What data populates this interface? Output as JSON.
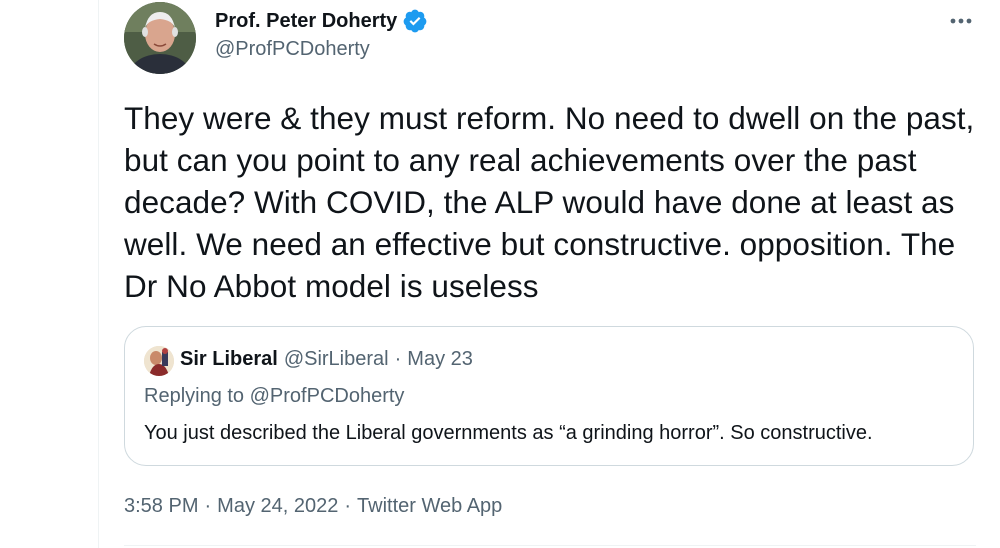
{
  "author": {
    "name": "Prof. Peter Doherty",
    "handle": "@ProfPCDoherty",
    "verified": true,
    "avatar_icon": "user-avatar-photo"
  },
  "tweet": {
    "text": "They were & they must reform. No need to dwell on the past, but can you point to any real achievements over the past decade? With COVID, the ALP would have done at least as well. We need an effective but constructive. opposition. The Dr No Abbot model is useless"
  },
  "quote": {
    "name": "Sir Liberal",
    "handle": "@SirLiberal",
    "separator": "·",
    "date": "May 23",
    "replying_to": "Replying to @ProfPCDoherty",
    "text": "You just described the Liberal governments as “a grinding horror”. So constructive."
  },
  "meta": {
    "time": "3:58 PM",
    "separator": "·",
    "date": "May 24, 2022",
    "source": "Twitter Web App"
  },
  "colors": {
    "verified_blue": "#1d9bf0",
    "secondary_text": "#536471",
    "border": "#cfd9de"
  }
}
